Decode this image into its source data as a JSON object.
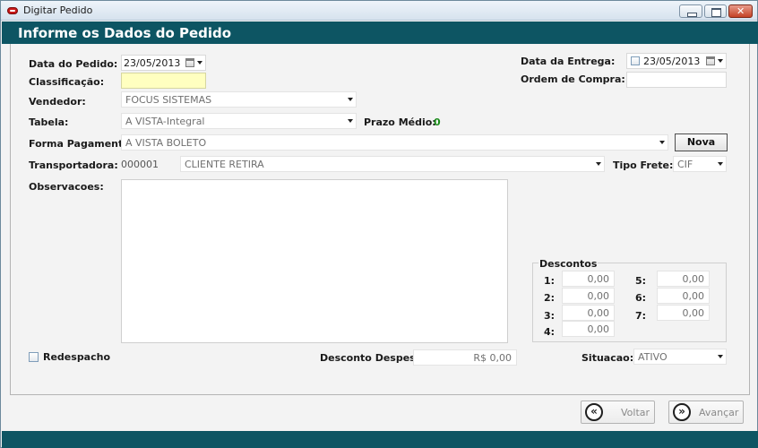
{
  "window": {
    "title": "Digitar Pedido"
  },
  "header": {
    "title": "Informe os Dados do Pedido"
  },
  "form": {
    "data_pedido_label": "Data do Pedido:",
    "data_pedido_value": "23/05/2013",
    "classificacao_label": "Classificação:",
    "classificacao_value": "",
    "vendedor_label": "Vendedor:",
    "vendedor_value": "FOCUS SISTEMAS",
    "tabela_label": "Tabela:",
    "tabela_value": "A VISTA-Integral",
    "prazo_medio_label": "Prazo Médio:",
    "prazo_medio_value": "0",
    "forma_pagamento_label": "Forma Pagamento:",
    "forma_pagamento_value": "A VISTA BOLETO",
    "nova_label": "Nova",
    "transportadora_label": "Transportadora:",
    "transportadora_code": "000001",
    "transportadora_value": "CLIENTE RETIRA",
    "tipo_frete_label": "Tipo Frete:",
    "tipo_frete_value": "CIF",
    "observacoes_label": "Observacoes:",
    "observacoes_value": "",
    "data_entrega_label": "Data da Entrega:",
    "data_entrega_value": "23/05/2013",
    "ordem_compra_label": "Ordem de Compra:",
    "ordem_compra_value": "",
    "redespacho_label": "Redespacho",
    "desconto_despesa_label": "Desconto Despesa:",
    "desconto_despesa_value": "R$ 0,00",
    "situacao_label": "Situacao:",
    "situacao_value": "ATIVO"
  },
  "descontos": {
    "title": "Descontos",
    "items": [
      {
        "label": "1:",
        "value": "0,00"
      },
      {
        "label": "2:",
        "value": "0,00"
      },
      {
        "label": "3:",
        "value": "0,00"
      },
      {
        "label": "4:",
        "value": "0,00"
      },
      {
        "label": "5:",
        "value": "0,00"
      },
      {
        "label": "6:",
        "value": "0,00"
      },
      {
        "label": "7:",
        "value": "0,00"
      }
    ]
  },
  "footer": {
    "voltar_label": "Voltar",
    "voltar_icon": "«",
    "avancar_label": "Avançar",
    "avancar_icon": "»"
  },
  "colors": {
    "header": "#0d5563",
    "classificacao_highlight": "#ffffc0",
    "prazo_value": "#1a8a1a"
  }
}
